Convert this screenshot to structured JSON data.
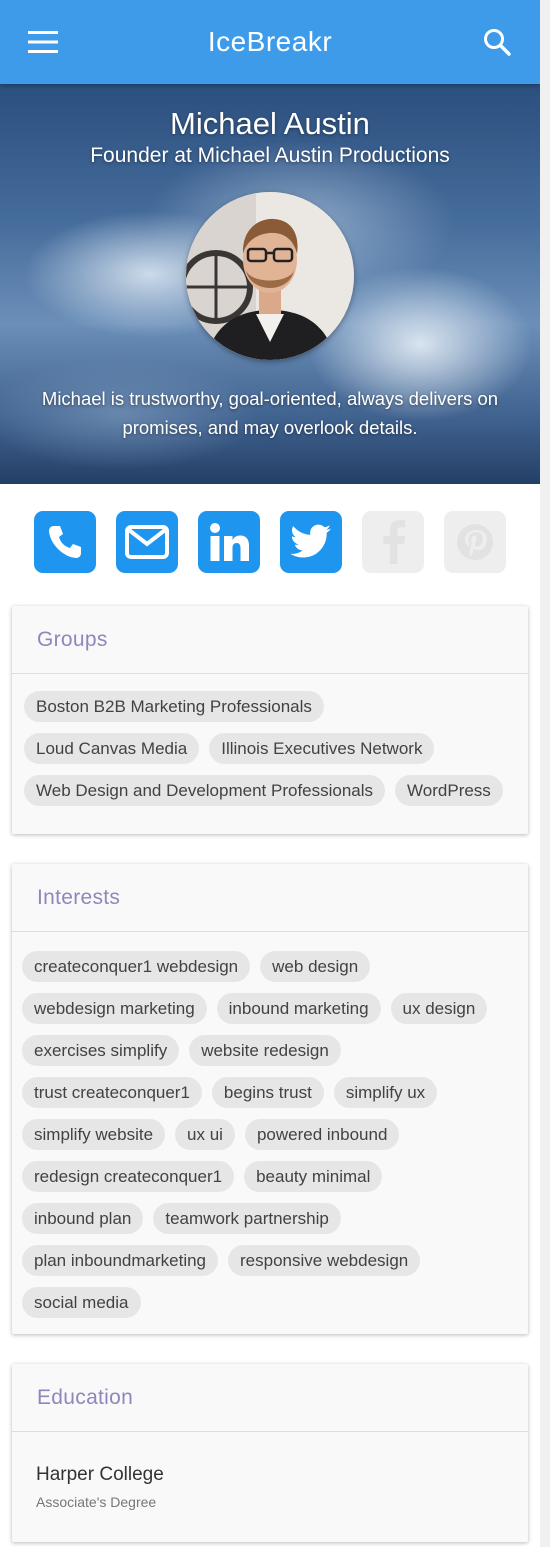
{
  "app": {
    "title": "IceBreakr"
  },
  "icons": {
    "menu": "menu-icon",
    "search": "search-icon"
  },
  "colors": {
    "appbar": "#3d9be9",
    "social_active": "#1e95ef",
    "social_inactive": "#eeeeee",
    "card_title": "#8e87bd"
  },
  "profile": {
    "name": "Michael Austin",
    "role": "Founder at Michael Austin Productions",
    "bio": "Michael is trustworthy, goal-oriented, always delivers on promises, and may overlook details."
  },
  "social": [
    {
      "name": "phone",
      "icon": "phone-icon",
      "active": true
    },
    {
      "name": "email",
      "icon": "envelope-icon",
      "active": true
    },
    {
      "name": "linkedin",
      "icon": "linkedin-icon",
      "active": true
    },
    {
      "name": "twitter",
      "icon": "twitter-icon",
      "active": true
    },
    {
      "name": "facebook",
      "icon": "facebook-icon",
      "active": false
    },
    {
      "name": "pinterest",
      "icon": "pinterest-icon",
      "active": false
    }
  ],
  "groups": {
    "title": "Groups",
    "items": [
      "Boston B2B Marketing Professionals",
      "Loud Canvas Media",
      "Illinois Executives Network",
      "Web Design and Development Professionals",
      "WordPress"
    ]
  },
  "interests": {
    "title": "Interests",
    "items": [
      "createconquer1 webdesign",
      "web design",
      "webdesign marketing",
      "inbound marketing",
      "ux design",
      "exercises simplify",
      "website redesign",
      "trust createconquer1",
      "begins trust",
      "simplify ux",
      "simplify website",
      "ux ui",
      "powered inbound",
      "redesign createconquer1",
      "beauty minimal",
      "inbound plan",
      "teamwork partnership",
      "plan inboundmarketing",
      "responsive webdesign",
      "social media"
    ]
  },
  "education": {
    "title": "Education",
    "items": [
      {
        "school": "Harper College",
        "degree": "Associate's Degree"
      }
    ]
  }
}
